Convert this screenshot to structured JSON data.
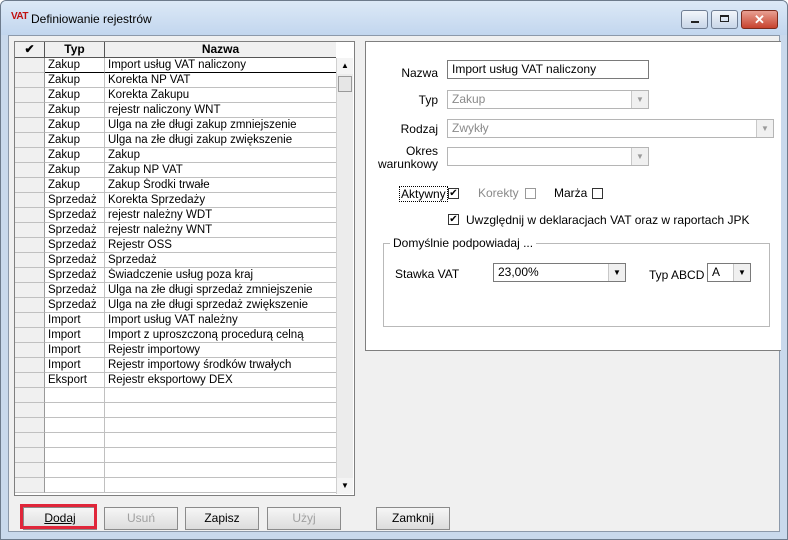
{
  "window": {
    "app_icon": "VAT",
    "title": "Definiowanie rejestrów",
    "controls": {
      "minimize": "",
      "maximize": "",
      "close": "✕"
    }
  },
  "grid": {
    "columns": [
      "✔",
      "Typ",
      "Nazwa"
    ],
    "rows": [
      {
        "typ": "Zakup",
        "nazwa": "Import usług VAT naliczony",
        "selected": true
      },
      {
        "typ": "Zakup",
        "nazwa": "Korekta NP VAT"
      },
      {
        "typ": "Zakup",
        "nazwa": "Korekta Zakupu"
      },
      {
        "typ": "Zakup",
        "nazwa": "rejestr naliczony WNT"
      },
      {
        "typ": "Zakup",
        "nazwa": "Ulga na złe długi zakup zmniejszenie"
      },
      {
        "typ": "Zakup",
        "nazwa": "Ulga na złe długi zakup zwiększenie"
      },
      {
        "typ": "Zakup",
        "nazwa": "Zakup"
      },
      {
        "typ": "Zakup",
        "nazwa": "Zakup NP VAT"
      },
      {
        "typ": "Zakup",
        "nazwa": "Zakup Środki trwałe"
      },
      {
        "typ": "Sprzedaż",
        "nazwa": "Korekta Sprzedaży"
      },
      {
        "typ": "Sprzedaż",
        "nazwa": "rejestr należny WDT"
      },
      {
        "typ": "Sprzedaż",
        "nazwa": "rejestr należny WNT"
      },
      {
        "typ": "Sprzedaż",
        "nazwa": "Rejestr OSS"
      },
      {
        "typ": "Sprzedaż",
        "nazwa": "Sprzedaż"
      },
      {
        "typ": "Sprzedaż",
        "nazwa": "Świadczenie usług poza kraj"
      },
      {
        "typ": "Sprzedaż",
        "nazwa": "Ulga na złe długi sprzedaż zmniejszenie"
      },
      {
        "typ": "Sprzedaż",
        "nazwa": "Ulga na złe długi sprzedaż zwiększenie"
      },
      {
        "typ": "Import",
        "nazwa": "Import usług VAT należny"
      },
      {
        "typ": "Import",
        "nazwa": "Import z uproszczoną procedurą celną"
      },
      {
        "typ": "Import",
        "nazwa": "Rejestr importowy"
      },
      {
        "typ": "Import",
        "nazwa": "Rejestr importowy środków trwałych"
      },
      {
        "typ": "Eksport",
        "nazwa": "Rejestr eksportowy DEX"
      },
      {
        "typ": "",
        "nazwa": ""
      },
      {
        "typ": "",
        "nazwa": ""
      },
      {
        "typ": "",
        "nazwa": ""
      },
      {
        "typ": "",
        "nazwa": ""
      },
      {
        "typ": "",
        "nazwa": ""
      },
      {
        "typ": "",
        "nazwa": ""
      },
      {
        "typ": "",
        "nazwa": ""
      }
    ],
    "scroll_up": "▲",
    "scroll_down": "▼"
  },
  "form": {
    "nazwa_label": "Nazwa",
    "nazwa_value": "Import usług VAT naliczony",
    "typ_label": "Typ",
    "typ_value": "Zakup",
    "rodzaj_label": "Rodzaj",
    "rodzaj_value": "Zwykły",
    "okres_label_1": "Okres",
    "okres_label_2": "warunkowy",
    "okres_value": "",
    "aktywny_label": "Aktywny",
    "aktywny_checked": "✔",
    "korekty_label": "Korekty",
    "marza_label": "Marża",
    "uwzglednij_label": "Uwzględnij w deklaracjach VAT oraz w raportach JPK",
    "uwzglednij_checked": "✔",
    "group_title": "Domyślnie podpowiadaj ...",
    "stawka_label": "Stawka VAT",
    "stawka_value": "23,00%",
    "typ_abcd_label": "Typ ABCD",
    "typ_abcd_value": "A",
    "dropdown_arrow": "▼"
  },
  "buttons": {
    "dodaj": "Dodaj",
    "usun": "Usuń",
    "zapisz": "Zapisz",
    "uzyj": "Użyj",
    "zamknij": "Zamknij"
  },
  "colors": {
    "highlight": "#e0263a",
    "title_gradient": "#c2d6ee"
  }
}
